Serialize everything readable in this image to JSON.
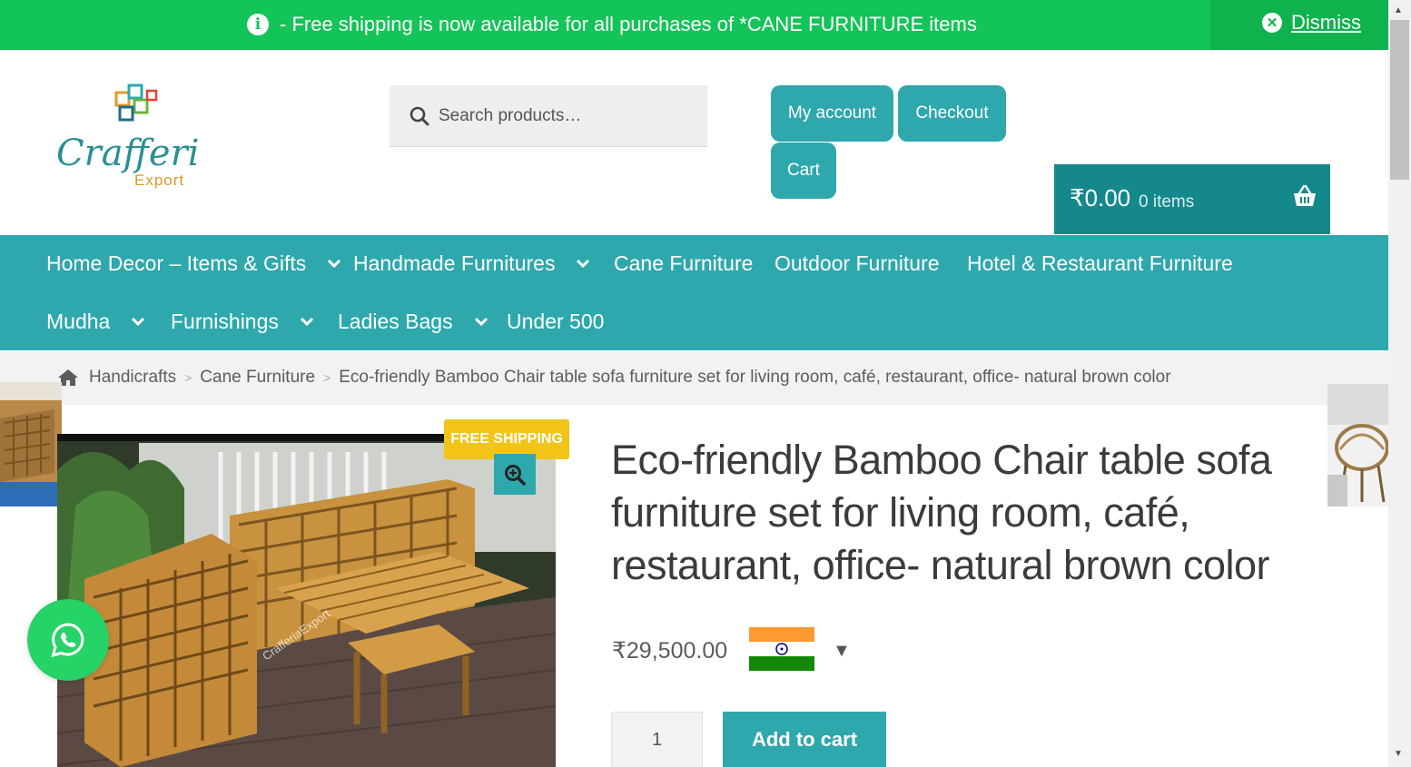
{
  "notice": {
    "message": "- Free shipping is now available for all purchases of *CANE FURNITURE items",
    "dismiss_label": "Dismiss"
  },
  "header": {
    "logo_text": "Crafferia",
    "logo_subtext": "Export",
    "search_placeholder": "Search products…",
    "buttons": {
      "my_account": "My account",
      "checkout": "Checkout",
      "cart": "Cart"
    },
    "cart": {
      "amount": "₹0.00",
      "items": "0 items"
    }
  },
  "nav": {
    "items": [
      {
        "label": "Home Decor – Items & Gifts",
        "has_dropdown": true
      },
      {
        "label": "Handmade Furnitures",
        "has_dropdown": true
      },
      {
        "label": "Cane Furniture",
        "has_dropdown": false
      },
      {
        "label": "Outdoor Furniture",
        "has_dropdown": false
      },
      {
        "label": "Hotel & Restaurant Furniture",
        "has_dropdown": false
      },
      {
        "label": "Mudha",
        "has_dropdown": true
      },
      {
        "label": "Furnishings",
        "has_dropdown": true
      },
      {
        "label": "Ladies Bags",
        "has_dropdown": true
      },
      {
        "label": "Under 500",
        "has_dropdown": false
      }
    ]
  },
  "breadcrumb": {
    "items": [
      "Handicrafts",
      "Cane Furniture",
      "Eco-friendly Bamboo Chair table sofa furniture set for living room, café, restaurant, office- natural brown color"
    ]
  },
  "product": {
    "badge": "FREE SHIPPING",
    "image_watermark": "CrafferiaExport",
    "title": "Eco-friendly Bamboo Chair table sofa furniture set for living room, café, restaurant, office- natural brown color",
    "price": "₹29,500.00",
    "currency_caret": "▼",
    "quantity": "1",
    "add_to_cart": "Add to cart"
  },
  "colors": {
    "accent": "#2ea8ac",
    "notice_green": "#13c458",
    "cart_dark": "#15888b",
    "badge_yellow": "#f2c418",
    "whatsapp": "#25d366"
  },
  "icons": [
    "info-icon",
    "close-circle-icon",
    "search-icon",
    "basket-icon",
    "chevron-down-icon",
    "home-icon",
    "zoom-icon",
    "whatsapp-icon",
    "india-flag-icon"
  ]
}
